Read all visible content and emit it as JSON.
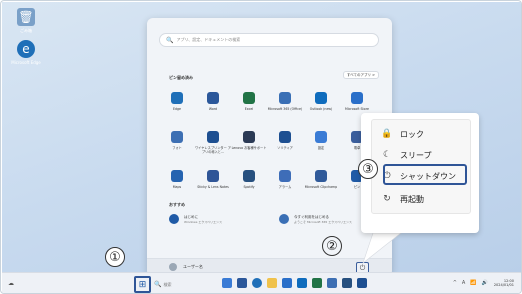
{
  "desktop": {
    "icons": [
      {
        "label": "ごみ箱",
        "icon": "recycle-bin-icon",
        "color": "#7aa0c8"
      },
      {
        "label": "Microsoft Edge",
        "icon": "edge-icon",
        "color": "#1f6fb8"
      }
    ]
  },
  "start_menu": {
    "search_placeholder": "アプリ、設定、ドキュメントの検索",
    "pinned_title": "ピン留め済み",
    "all_apps_label": "すべてのアプリ  >",
    "pinned_apps": [
      {
        "label": "Edge",
        "icon": "edge-icon",
        "color": "#1f6fb8"
      },
      {
        "label": "Word",
        "icon": "word-icon",
        "color": "#2b579a"
      },
      {
        "label": "Excel",
        "icon": "excel-icon",
        "color": "#217346"
      },
      {
        "label": "Microsoft 365 (Office)",
        "icon": "office-icon",
        "color": "#3a6fb5"
      },
      {
        "label": "Outlook (new)",
        "icon": "outlook-icon",
        "color": "#0f6cbd"
      },
      {
        "label": "Microsoft Store",
        "icon": "store-icon",
        "color": "#2a6fc9"
      },
      {
        "label": "フォト",
        "icon": "photos-icon",
        "color": "#3d6fb3"
      },
      {
        "label": "ワイヤレスプリンター アプリの導入と…",
        "icon": "printer-app-icon",
        "color": "#1d4f91"
      },
      {
        "label": "Lenovo お客様サポート",
        "icon": "support-icon",
        "color": "#2b3a55"
      },
      {
        "label": "ソリティア",
        "icon": "solitaire-icon",
        "color": "#1d4f91"
      },
      {
        "label": "設定",
        "icon": "settings-icon",
        "color": "#3a7bd5"
      },
      {
        "label": "電卓",
        "icon": "calculator-icon",
        "color": "#3b5e9c"
      },
      {
        "label": "Maps",
        "icon": "maps-icon",
        "color": "#2563b0"
      },
      {
        "label": "Sticky & Lens Notes",
        "icon": "notes-icon",
        "color": "#2f5597"
      },
      {
        "label": "Spotify",
        "icon": "spotify-icon",
        "color": "#27507f"
      },
      {
        "label": "アラーム",
        "icon": "clock-icon",
        "color": "#3e6db8"
      },
      {
        "label": "Microsoft Clipchamp",
        "icon": "clipchamp-icon",
        "color": "#305a9a"
      },
      {
        "label": "ピン",
        "icon": "app-icon",
        "color": "#1f5aa6"
      }
    ],
    "recommended_title": "おすすめ",
    "recommended": [
      {
        "title": "はじめに",
        "subtitle": "Windows エクスペリエンス",
        "icon": "getstarted-icon"
      },
      {
        "title": "今すぐ利用をはじめる",
        "subtitle": "ようこそ Microsoft 365 エクスペリエンス",
        "icon": "welcome-icon"
      }
    ],
    "user_name": "ユーザー名",
    "power_icon": "power-icon"
  },
  "power_menu": {
    "items": [
      {
        "label": "ロック",
        "icon": "lock-icon",
        "glyph": "🔒"
      },
      {
        "label": "スリープ",
        "icon": "sleep-icon",
        "glyph": "☾"
      },
      {
        "label": "シャットダウン",
        "icon": "power-icon",
        "glyph": "⏻"
      },
      {
        "label": "再起動",
        "icon": "restart-icon",
        "glyph": "↻"
      }
    ]
  },
  "callouts": {
    "step1": "①",
    "step2": "②",
    "step3": "③"
  },
  "taskbar": {
    "left_weather": "☁",
    "search_label": "検索",
    "tray_symbols": [
      "^",
      "A",
      "📶",
      "🔊"
    ],
    "clock_time": "12:00",
    "clock_date": "2024/01/01"
  },
  "colors": {
    "accent": "#2f5597",
    "start_bg": "#f1f4f8"
  }
}
